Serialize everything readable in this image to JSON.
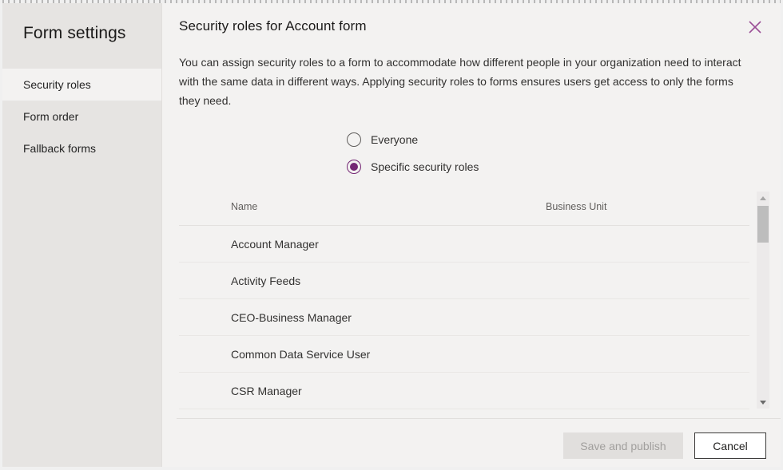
{
  "sidebar": {
    "title": "Form settings",
    "items": [
      {
        "label": "Security roles",
        "selected": true
      },
      {
        "label": "Form order",
        "selected": false
      },
      {
        "label": "Fallback forms",
        "selected": false
      }
    ]
  },
  "dialog": {
    "title": "Security roles for Account form",
    "description": "You can assign security roles to a form to accommodate how different people in your organization need to interact with the same data in different ways. Applying security roles to forms ensures users get access to only the forms they need.",
    "close_icon": "close-icon",
    "close_icon_color": "#9b4f96"
  },
  "radio_options": [
    {
      "label": "Everyone",
      "checked": false
    },
    {
      "label": "Specific security roles",
      "checked": true
    }
  ],
  "table": {
    "columns": [
      "",
      "Name",
      "Business Unit"
    ],
    "rows": [
      {
        "name": "Account Manager",
        "business_unit": ""
      },
      {
        "name": "Activity Feeds",
        "business_unit": ""
      },
      {
        "name": "CEO-Business Manager",
        "business_unit": ""
      },
      {
        "name": "Common Data Service User",
        "business_unit": ""
      },
      {
        "name": "CSR Manager",
        "business_unit": ""
      }
    ]
  },
  "scrollbar": {
    "up_icon": "caret-up-icon",
    "down_icon": "caret-down-icon"
  },
  "footer": {
    "save_label": "Save and publish",
    "save_disabled": true,
    "cancel_label": "Cancel"
  },
  "colors": {
    "accent": "#742774",
    "sidebar_bg": "#e6e4e2",
    "panel_bg": "#f3f2f1"
  }
}
